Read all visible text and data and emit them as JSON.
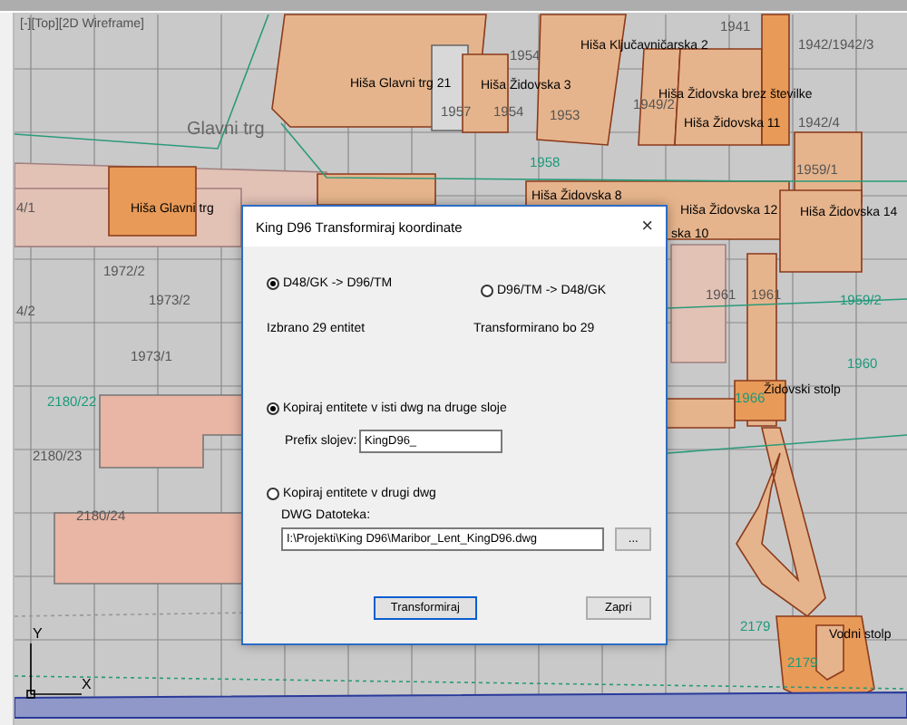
{
  "viewport": {
    "label": "[-][Top][2D Wireframe]"
  },
  "map_labels": [
    {
      "text": "Hiša Glavni trg 21",
      "kind": "building"
    },
    {
      "text": "Hiša Židovska 3",
      "kind": "building"
    },
    {
      "text": "Hiša Ključavničarska 2",
      "kind": "building"
    },
    {
      "text": "Hiša Židovska brez številke",
      "kind": "building"
    },
    {
      "text": "Hiša Židovska 11",
      "kind": "building"
    },
    {
      "text": "Glavni trg",
      "kind": "street"
    },
    {
      "text": "1958",
      "kind": "parcel-green"
    },
    {
      "text": "1957",
      "kind": "parcel"
    },
    {
      "text": "1954",
      "kind": "parcel"
    },
    {
      "text": "1954",
      "kind": "parcel"
    },
    {
      "text": "1953",
      "kind": "parcel"
    },
    {
      "text": "1949/2",
      "kind": "parcel"
    },
    {
      "text": "1941",
      "kind": "parcel"
    },
    {
      "text": "1942/1942/3",
      "kind": "parcel"
    },
    {
      "text": "1942/4",
      "kind": "parcel"
    },
    {
      "text": "1959/1",
      "kind": "parcel"
    },
    {
      "text": "Hiša Glavni trg",
      "kind": "building"
    },
    {
      "text": "Hiša Židovska 8",
      "kind": "building"
    },
    {
      "text": "Hiša Židovska 12",
      "kind": "building"
    },
    {
      "text": "Hiša Židovska 14",
      "kind": "building"
    },
    {
      "text": "ska 10",
      "kind": "building"
    },
    {
      "text": "1961",
      "kind": "parcel"
    },
    {
      "text": "1961",
      "kind": "parcel"
    },
    {
      "text": "1959/2",
      "kind": "parcel-green"
    },
    {
      "text": "1960",
      "kind": "parcel-green"
    },
    {
      "text": "Židovski stolp",
      "kind": "building"
    },
    {
      "text": "1966",
      "kind": "parcel-green"
    },
    {
      "text": "2179",
      "kind": "parcel-green"
    },
    {
      "text": "2179",
      "kind": "parcel-green"
    },
    {
      "text": "Vodni stolp",
      "kind": "building"
    },
    {
      "text": "1972/2",
      "kind": "parcel"
    },
    {
      "text": "1973/2",
      "kind": "parcel"
    },
    {
      "text": "1973/1",
      "kind": "parcel"
    },
    {
      "text": "2180/22",
      "kind": "parcel-green"
    },
    {
      "text": "2180/23",
      "kind": "parcel"
    },
    {
      "text": "2180/24",
      "kind": "parcel"
    },
    {
      "text": "4/1",
      "kind": "parcel"
    },
    {
      "text": "4/2",
      "kind": "parcel"
    }
  ],
  "axis_labels": [
    "Y",
    "X"
  ],
  "dialog": {
    "title": "King D96 Transformiraj koordinate",
    "close": "×",
    "directions": [
      {
        "label": "D48/GK -> D96/TM",
        "selected": true
      },
      {
        "label": "D96/TM -> D48/GK",
        "selected": false
      }
    ],
    "selected_count": "Izbrano 29 entitet",
    "transform_count": "Transformirano bo 29",
    "copy_same": {
      "label": "Kopiraj entitete v isti dwg na druge sloje",
      "selected": true
    },
    "prefix": {
      "label": "Prefix slojev:",
      "value": "KingD96_"
    },
    "copy_other": {
      "label": "Kopiraj entitete v drugi dwg",
      "selected": false
    },
    "file": {
      "label": "DWG Datoteka:",
      "value": "I:\\Projekti\\King D96\\Maribor_Lent_KingD96.dwg",
      "browse": "..."
    },
    "buttons": [
      {
        "label": "Transformiraj",
        "focused": true
      },
      {
        "label": "Zapri",
        "focused": false
      }
    ]
  }
}
